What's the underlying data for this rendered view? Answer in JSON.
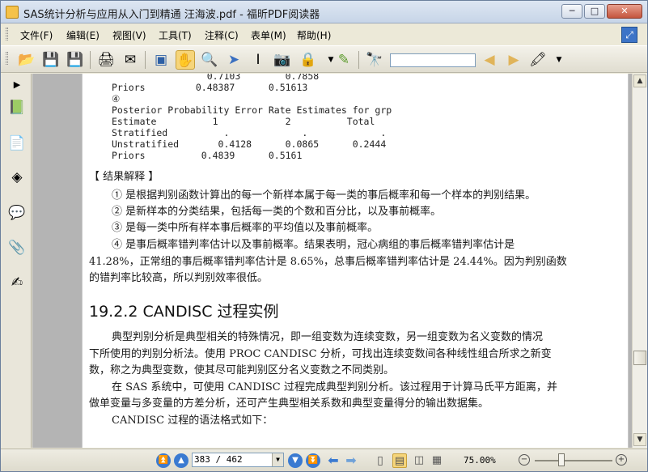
{
  "window": {
    "title": "SAS统计分析与应用从入门到精通 汪海波.pdf - 福昕PDF阅读器",
    "min": "─",
    "max": "□",
    "close": "✕"
  },
  "menu": [
    "文件(F)",
    "编辑(E)",
    "视图(V)",
    "工具(T)",
    "注释(C)",
    "表单(M)",
    "帮助(H)"
  ],
  "toolbar_icons": [
    "open-icon",
    "save-icon",
    "save-as-icon",
    "print-icon",
    "email-icon",
    "fullscreen-icon",
    "hand-tool-icon",
    "zoom-tool-icon",
    "select-tool-icon",
    "text-select-icon",
    "snapshot-icon",
    "rms-icon",
    "typewriter-icon",
    "binoculars-icon",
    "search-prev-icon",
    "search-next-icon",
    "highlight-icon"
  ],
  "sidebar_icons": [
    "expand-arrow-icon",
    "bookmarks-icon",
    "pages-icon",
    "layers-icon",
    "comments-icon",
    "attachments-icon",
    "signatures-icon"
  ],
  "doc": {
    "mono": [
      "                 0.7103        0.7858",
      "Priors         0.48387      0.51613",
      "④",
      "Posterior Probability Error Rate Estimates for grp",
      "Estimate          1            2          Total",
      "Stratified          .             .             .",
      "Unstratified       0.4128      0.0865      0.2444",
      "Priors          0.4839      0.5161"
    ],
    "section_title": "【 结果解释 】",
    "items": [
      "① 是根据判别函数计算出的每一个新样本属于每一类的事后概率和每一个样本的判别结果。",
      "② 是新样本的分类结果，包括每一类的个数和百分比，以及事前概率。",
      "③ 是每一类中所有样本事后概率的平均值以及事前概率。",
      "④ 是事后概率错判率估计以及事前概率。结果表明，冠心病组的事后概率错判率估计是"
    ],
    "item4_cont": [
      "41.28%，正常组的事后概率错判率估计是 8.65%，总事后概率错判率估计是 24.44%。因为判别函数",
      "的错判率比较高，所以判别效率很低。"
    ],
    "heading": "19.2.2    CANDISC 过程实例",
    "para1": [
      "典型判别分析是典型相关的特殊情况，即一组变数为连续变数，另一组变数为名义变数的情况",
      "下所使用的判别分析法。使用 PROC CANDISC 分析，可找出连续变数间各种线性组合所求之新变",
      "数，称之为典型变数，使其尽可能判别区分名义变数之不同类别。"
    ],
    "para2": [
      "在 SAS 系统中，可使用 CANDISC 过程完成典型判别分析。该过程用于计算马氏平方距离，并",
      "做单变量与多变量的方差分析，还可产生典型相关系数和典型变量得分的输出数据集。"
    ],
    "para3": "CANDISC 过程的语法格式如下："
  },
  "status": {
    "page_value": "383 / 462",
    "zoom_value": "75.00%",
    "zoom_minus": "−",
    "zoom_plus": "+"
  }
}
